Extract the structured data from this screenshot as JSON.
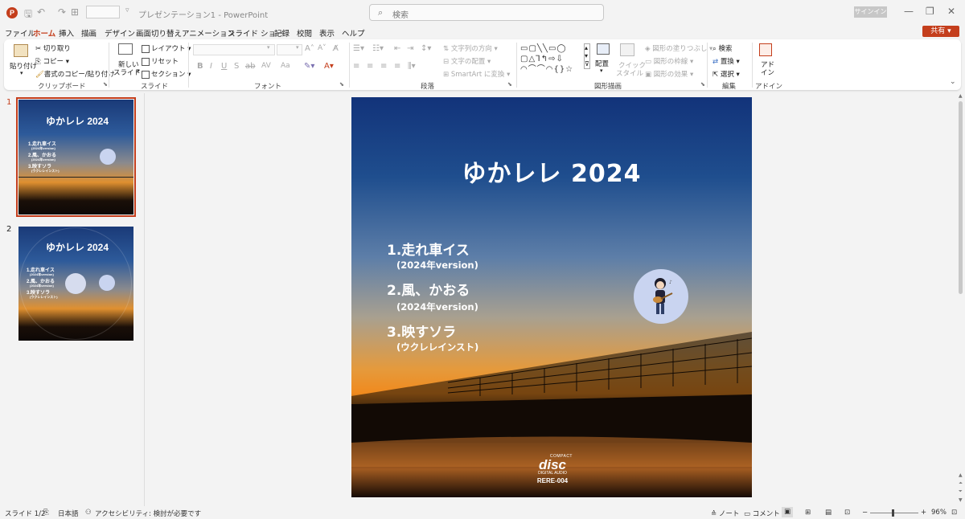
{
  "app": {
    "doc_title": "プレゼンテーション1 - PowerPoint",
    "search_placeholder": "検索",
    "signin": "サインイン",
    "share": "共有"
  },
  "menu": [
    "ファイル",
    "ホーム",
    "挿入",
    "描画",
    "デザイン",
    "画面切り替え",
    "アニメーション",
    "スライド ショー",
    "記録",
    "校閲",
    "表示",
    "ヘルプ"
  ],
  "ribbon": {
    "clipboard": {
      "paste": "貼り付け",
      "cut": "切り取り",
      "copy": "コピー",
      "format_painter": "書式のコピー/貼り付け",
      "label": "クリップボード"
    },
    "slides": {
      "new_slide": "新しい",
      "new_slide2": "スライド",
      "layout": "レイアウト",
      "reset": "リセット",
      "section": "セクション",
      "label": "スライド"
    },
    "font": {
      "label": "フォント"
    },
    "paragraph": {
      "text_direction": "文字列の方向",
      "align_text": "文字の配置",
      "smartart": "SmartArt に変換",
      "label": "段落"
    },
    "drawing": {
      "arrange": "配置",
      "quick_styles": "クイック",
      "quick_styles2": "スタイル",
      "shape_fill": "図形の塗りつぶし",
      "shape_outline": "図形の枠線",
      "shape_effects": "図形の効果",
      "label": "図形描画"
    },
    "editing": {
      "find": "検索",
      "replace": "置換",
      "select": "選択",
      "label": "編集"
    },
    "addins": {
      "addin": "アド",
      "addin2": "イン",
      "label": "アドイン"
    }
  },
  "thumbnails": [
    {
      "num": "1",
      "title": "ゆかレレ 2024",
      "t1": "1.走れ車イス",
      "t1s": "(2024年version)",
      "t2": "2.風、かおる",
      "t2s": "(2024年version)",
      "t3": "3.映すソラ",
      "t3s": "(ウクレレインスト)"
    },
    {
      "num": "2",
      "title": "ゆかレレ 2024",
      "t1": "1.走れ車イス",
      "t1s": "(2024年version)",
      "t2": "2.風、かおる",
      "t2s": "(2024年version)",
      "t3": "3.映すソラ",
      "t3s": "(ウクレレインスト)"
    }
  ],
  "slide": {
    "title": "ゆかレレ 2024",
    "tracks": [
      {
        "title": "1.走れ車イス",
        "sub": "(2024年version)"
      },
      {
        "title": "2.風、かおる",
        "sub": "(2024年version)"
      },
      {
        "title": "3.映すソラ",
        "sub": "(ウクレレインスト)"
      }
    ],
    "cd_compact": "COMPACT",
    "cd_disc": "disc",
    "cd_digital": "DIGITAL AUDIO",
    "catalog": "RERE-004"
  },
  "status": {
    "slide_count": "スライド 1/2",
    "language": "日本語",
    "accessibility": "アクセシビリティ: 検討が必要です",
    "notes": "ノート",
    "comments": "コメント",
    "zoom": "96%"
  }
}
